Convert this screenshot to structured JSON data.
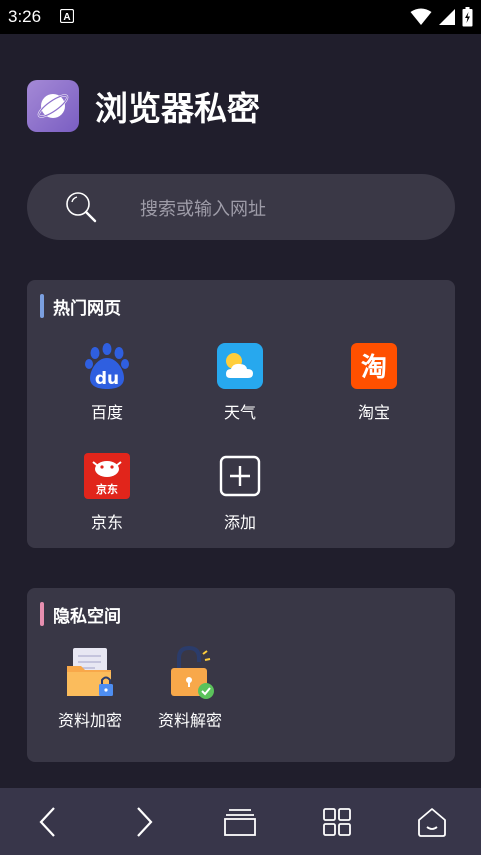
{
  "status_bar": {
    "time": "3:26",
    "notification_icon": "a-notification-icon",
    "wifi_icon": "wifi-icon",
    "signal_icon": "signal-icon",
    "battery_icon": "battery-charging-icon"
  },
  "header": {
    "logo_icon": "planet-icon",
    "title": "浏览器私密"
  },
  "search": {
    "icon": "search-icon",
    "placeholder": "搜索或输入网址"
  },
  "hot_sites": {
    "title": "热门网页",
    "accent_color": "#7b9fe0",
    "items": [
      {
        "label": "百度",
        "icon": "baidu-icon"
      },
      {
        "label": "天气",
        "icon": "weather-icon"
      },
      {
        "label": "淘宝",
        "icon": "taobao-icon"
      },
      {
        "label": "京东",
        "icon": "jd-icon"
      },
      {
        "label": "添加",
        "icon": "add-icon"
      }
    ]
  },
  "private_space": {
    "title": "隐私空间",
    "accent_color": "#e78fb0",
    "items": [
      {
        "label": "资料加密",
        "icon": "folder-lock-icon"
      },
      {
        "label": "资料解密",
        "icon": "unlock-icon"
      }
    ]
  },
  "bottom_nav": {
    "items": [
      "back-icon",
      "forward-icon",
      "tabs-icon",
      "grid-icon",
      "home-icon"
    ]
  },
  "colors": {
    "background": "#201e2c",
    "card": "#393746",
    "baidu_blue": "#2f5fe0",
    "taobao_orange": "#ff5000",
    "jd_red": "#e1251b"
  }
}
